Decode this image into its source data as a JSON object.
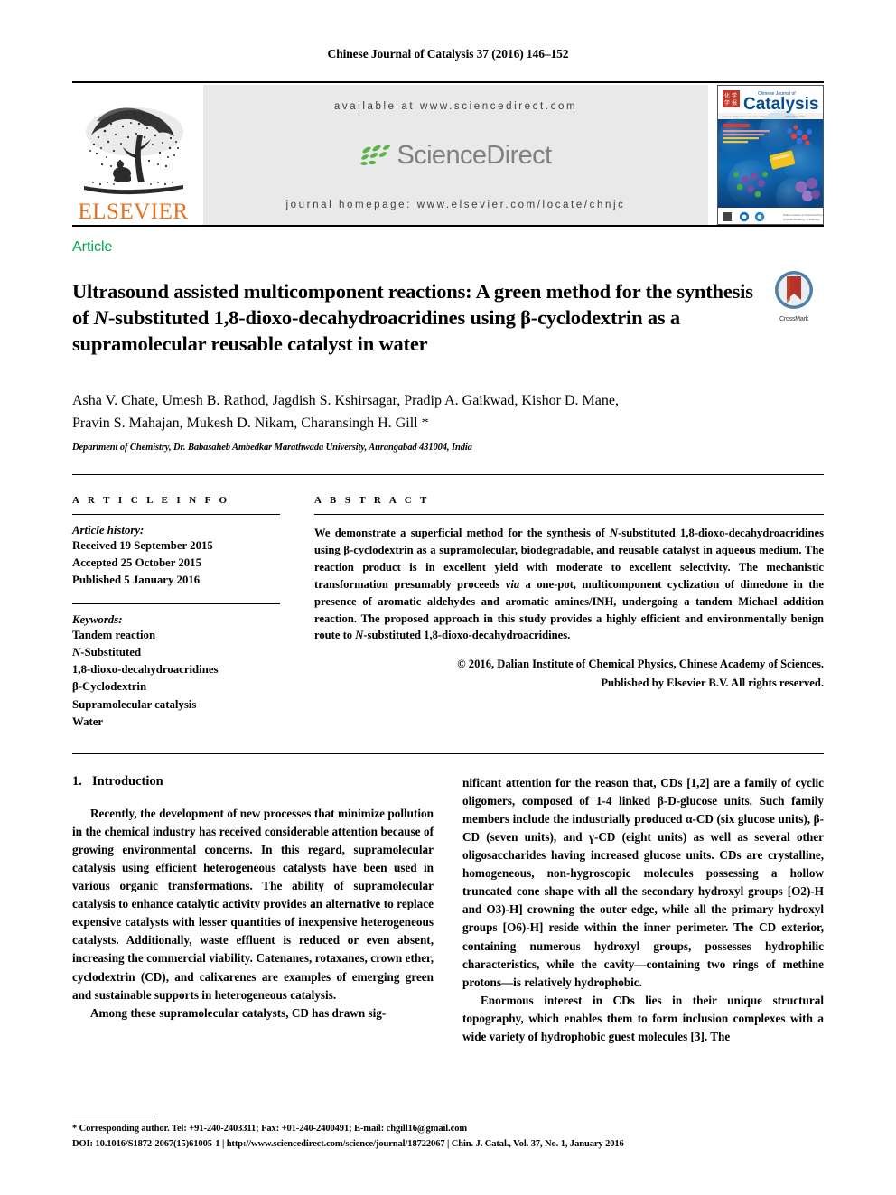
{
  "running_head": "Chinese Journal of Catalysis 37 (2016) 146–152",
  "masthead": {
    "publisher_name": "ELSEVIER",
    "available_at": "available at www.sciencedirect.com",
    "sciencedirect_label": "ScienceDirect",
    "journal_homepage": "journal homepage: www.elsevier.com/locate/chnjc",
    "cover": {
      "journal_kicker": "Chinese Journal of",
      "journal_name": "Catalysis"
    }
  },
  "article_type": "Article",
  "title": {
    "part1": "Ultrasound assisted multicomponent reactions: A green method for the synthesis of ",
    "italic1": "N",
    "part2": "-substituted 1,8-dioxo-decahydroacridines using β-cyclodextrin as a supramolecular reusable catalyst in water"
  },
  "crossmark": {
    "label": "CrossMark"
  },
  "authors": {
    "line1": "Asha V. Chate, Umesh B. Rathod, Jagdish S. Kshirsagar, Pradip A. Gaikwad, Kishor D. Mane,",
    "line2": "Pravin S. Mahajan, Mukesh D. Nikam, Charansingh H. Gill *"
  },
  "affiliation": "Department of Chemistry, Dr. Babasaheb Ambedkar Marathwada University, Aurangabad 431004, India",
  "article_info": {
    "heading": "A R T I C L E   I N F O",
    "history_label": "Article history:",
    "history": [
      "Received 19 September 2015",
      "Accepted 25 October 2015",
      "Published 5 January 2016"
    ],
    "keywords_label": "Keywords:",
    "keywords": [
      "Tandem reaction",
      "N-Substituted",
      "1,8-dioxo-decahydroacridines",
      "β-Cyclodextrin",
      "Supramolecular catalysis",
      "Water"
    ]
  },
  "abstract": {
    "heading": "A B S T R A C T",
    "text_a": "We demonstrate a superficial method for the synthesis of ",
    "text_b": "N",
    "text_c": "-substituted 1,8-dioxo-decahydroacridines using β-cyclodextrin as a supramolecular, biodegradable, and reusable catalyst in aqueous medium. The reaction product is in excellent yield with moderate to excellent selectivity. The mechanistic transformation presumably proceeds ",
    "text_d": "via",
    "text_e": " a one-pot, multicomponent cyclization of dimedone in the presence of aromatic aldehydes and aromatic amines/INH, undergoing a tandem Michael addition reaction. The proposed approach in this study provides a highly efficient and environmentally benign route to ",
    "text_f": "N",
    "text_g": "-substituted 1,8-dioxo-decahydroacridines.",
    "copyright_line1": "© 2016, Dalian Institute of Chemical Physics, Chinese Academy of Sciences.",
    "copyright_line2": "Published by Elsevier B.V. All rights reserved."
  },
  "body": {
    "section_number": "1.",
    "section_title": "Introduction",
    "left_para1": "Recently, the development of new processes that minimize pollution in the chemical industry has received considerable attention because of growing environmental concerns. In this regard, supramolecular catalysis using efficient heterogeneous catalysts have been used in various organic transformations. The ability of supramolecular catalysis to enhance catalytic activity provides an alternative to replace expensive catalysts with lesser quantities of inexpensive heterogeneous catalysts. Additionally, waste effluent is reduced or even absent, increasing the commercial viability. Catenanes, rotaxanes, crown ether, cyclodextrin (CD), and calixarenes are examples of emerging green and sustainable supports in heterogeneous catalysis.",
    "left_para2": "Among these supramolecular catalysts, CD has drawn sig-",
    "right_para1": "nificant attention for the reason that, CDs [1,2] are a family of cyclic oligomers, composed of 1-4 linked β-D-glucose units. Such family members include the industrially produced α-CD (six glucose units), β-CD (seven units), and γ-CD (eight units) as well as several other oligosaccharides having increased glucose units. CDs are crystalline, homogeneous, non-hygroscopic molecules possessing a hollow truncated cone shape with all the secondary hydroxyl groups [O2)-H and O3)-H] crowning the outer edge, while all the primary hydroxyl groups [O6)-H] reside within the inner perimeter. The CD exterior, containing numerous hydroxyl groups, possesses hydrophilic characteristics, while the cavity—containing two rings of methine protons—is relatively hydrophobic.",
    "right_para2": "Enormous interest in CDs lies in their unique structural topography, which enables them to form inclusion complexes with a wide variety of hydrophobic guest molecules [3]. The"
  },
  "footer": {
    "corresponding": "* Corresponding author. Tel: +91-240-2403311; Fax: +01-240-2400491; E-mail: chgill16@gmail.com",
    "doi_line": "DOI: 10.1016/S1872-2067(15)61005-1 | http://www.sciencedirect.com/science/journal/18722067 | Chin. J. Catal., Vol. 37, No. 1, January 2016"
  },
  "colors": {
    "elsevier_orange": "#E9711C",
    "article_green": "#00A44E",
    "sciencedirect_gray": "#808080",
    "sciencedirect_green": "#5CB247",
    "banner_bg": "#e9e9e9"
  }
}
